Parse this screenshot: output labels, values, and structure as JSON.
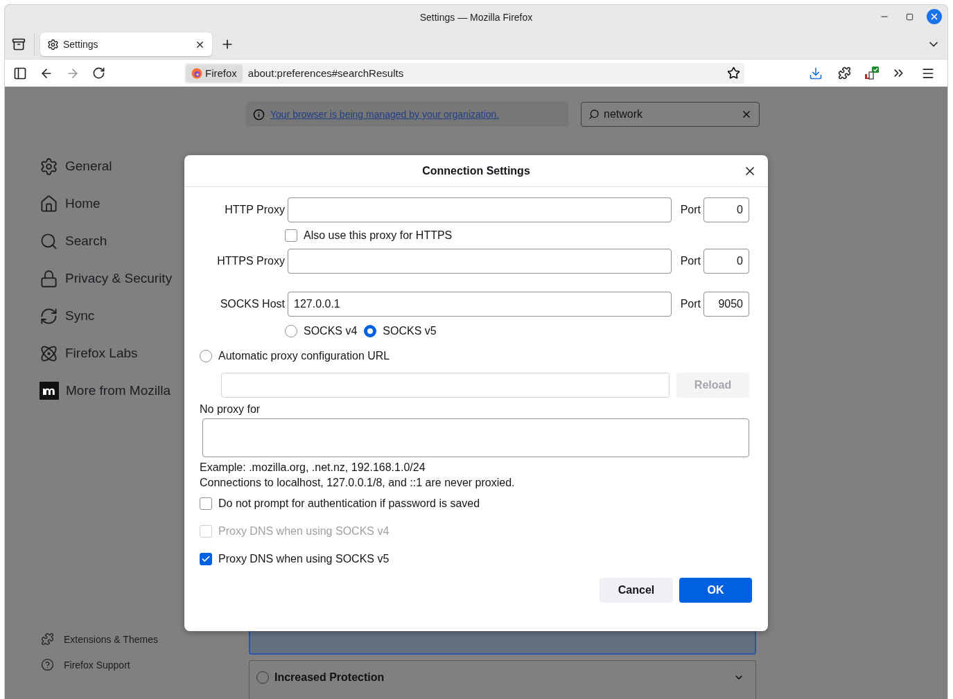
{
  "window": {
    "title": "Settings — Mozilla Firefox"
  },
  "tabs": [
    {
      "label": "Settings",
      "selected": true
    }
  ],
  "toolbar": {
    "identity": "Firefox",
    "url": "about:preferences#searchResults"
  },
  "sidebar": {
    "items": [
      {
        "label": "General",
        "selected": false
      },
      {
        "label": "Home",
        "selected": false
      },
      {
        "label": "Search",
        "selected": false
      },
      {
        "label": "Privacy & Security",
        "selected": false
      },
      {
        "label": "Sync",
        "selected": false
      },
      {
        "label": "Firefox Labs",
        "selected": false
      },
      {
        "label": "More from Mozilla",
        "selected": false
      }
    ],
    "footer": [
      {
        "label": "Extensions & Themes"
      },
      {
        "label": "Firefox Support"
      }
    ]
  },
  "notice": {
    "text": "Your browser is being managed by your organization."
  },
  "search": {
    "value": "network"
  },
  "cards": [
    {
      "title": "Increased Protection",
      "selected": false
    }
  ],
  "dialog": {
    "title": "Connection Settings",
    "proxies": [
      {
        "label": "HTTP Proxy",
        "port_label": "Port",
        "port": "0"
      },
      {
        "label": "HTTPS Proxy",
        "port_label": "Port",
        "port": "0"
      },
      {
        "label": "SOCKS Host",
        "value": "127.0.0.1",
        "port_label": "Port",
        "port": "9050"
      }
    ],
    "also_https": {
      "label": "Also use this proxy for HTTPS",
      "checked": false
    },
    "socks_versions": [
      {
        "label": "SOCKS v4",
        "selected": false
      },
      {
        "label": "SOCKS v5",
        "selected": true
      }
    ],
    "auto": {
      "label": "Automatic proxy configuration URL",
      "selected": false,
      "reload": "Reload",
      "reload_disabled": true
    },
    "no_proxy": {
      "label": "No proxy for",
      "example": "Example: .mozilla.org, .net.nz, 192.168.1.0/24",
      "note": "Connections to localhost, 127.0.0.1/8, and ::1 are never proxied."
    },
    "options": [
      {
        "label": "Do not prompt for authentication if password is saved",
        "checked": false,
        "disabled": false
      },
      {
        "label": "Proxy DNS when using SOCKS v4",
        "checked": false,
        "disabled": true
      },
      {
        "label": "Proxy DNS when using SOCKS v5",
        "checked": true,
        "disabled": false
      }
    ],
    "buttons": {
      "cancel": "Cancel",
      "ok": "OK"
    }
  }
}
